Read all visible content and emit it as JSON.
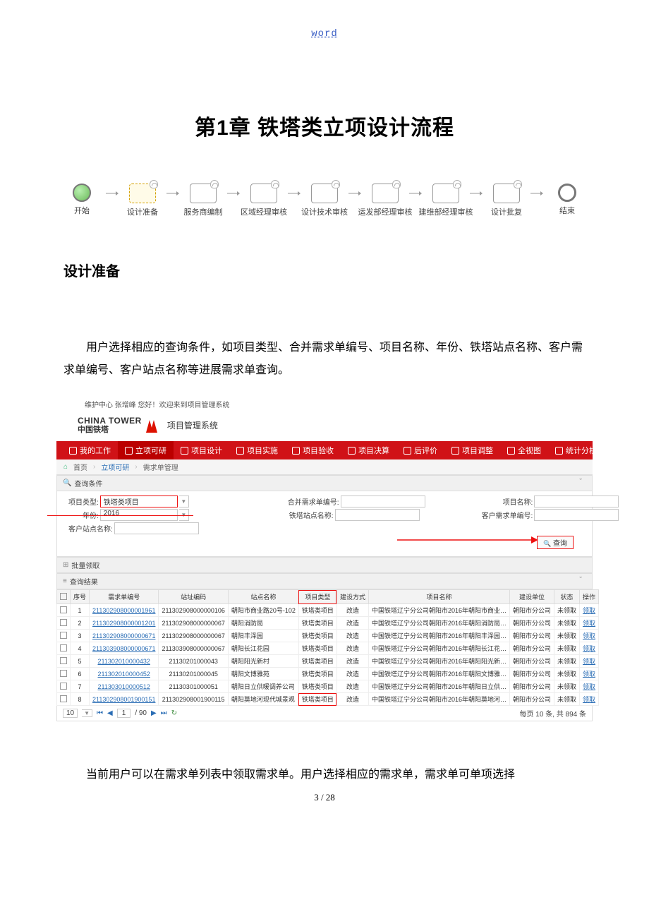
{
  "header_word": "word",
  "title": "第1章 铁塔类立项设计流程",
  "flow": [
    "开始",
    "设计准备",
    "服务商编制",
    "区域经理审核",
    "设计技术审核",
    "运发部经理审核",
    "建维部经理审核",
    "设计批复",
    "结束"
  ],
  "section_heading": "设计准备",
  "paragraph1": "用户选择相应的查询条件，如项目类型、合并需求单编号、项目名称、年份、铁塔站点名称、客户需求单编号、客户站点名称等进展需求单查询。",
  "ui": {
    "topbar": "维护中心   张增峰   您好！欢迎来到项目管理系统",
    "brand_en": "CHINA TOWER",
    "brand_cn": "中国铁塔",
    "brand_sys": "项目管理系统",
    "nav": [
      "我的工作",
      "立项可研",
      "项目设计",
      "项目实施",
      "项目验收",
      "项目决算",
      "后评价",
      "项目调整",
      "全视图",
      "统计分析"
    ],
    "crumbs": [
      "首页",
      "立项可研",
      "需求单管理"
    ],
    "panel_query": "查询条件",
    "form": {
      "f1_label": "项目类型:",
      "f1_value": "铁塔类项目",
      "f2_label": "合并需求单编号:",
      "f2_value": "",
      "f3_label": "项目名称:",
      "f3_value": "",
      "f4_label": "年份:",
      "f4_value": "2016",
      "f5_label": "铁塔站点名称:",
      "f5_value": "",
      "f6_label": "客户需求单编号:",
      "f6_value": "",
      "f7_label": "客户站点名称:",
      "f7_value": "",
      "search_btn": "查询"
    },
    "panel_batch": "批量领取",
    "panel_result": "查询结果",
    "cols": [
      "",
      "序号",
      "需求单编号",
      "站址编码",
      "站点名称",
      "项目类型",
      "建设方式",
      "项目名称",
      "建设单位",
      "状态",
      "操作"
    ],
    "rows": [
      {
        "n": "1",
        "req": "211302908000001961",
        "site": "211302908000000106",
        "name": "朝阳市商业路20号-102",
        "type": "铁塔类项目",
        "mode": "改造",
        "proj": "中国铁塔辽宁分公司朝阳市2016年朝阳市商业…",
        "unit": "朝阳市分公司",
        "st": "未领取",
        "op": "领取"
      },
      {
        "n": "2",
        "req": "211302908000001201",
        "site": "211302908000000067",
        "name": "朝阳消防局",
        "type": "铁塔类项目",
        "mode": "改造",
        "proj": "中国铁塔辽宁分公司朝阳市2016年朝阳消防局…",
        "unit": "朝阳市分公司",
        "st": "未领取",
        "op": "领取"
      },
      {
        "n": "3",
        "req": "211302908000000671",
        "site": "211302908000000067",
        "name": "朝阳丰泽园",
        "type": "铁塔类项目",
        "mode": "改造",
        "proj": "中国铁塔辽宁分公司朝阳市2016年朝阳丰泽园…",
        "unit": "朝阳市分公司",
        "st": "未领取",
        "op": "领取"
      },
      {
        "n": "4",
        "req": "211303908000000671",
        "site": "211303908000000067",
        "name": "朝阳长江花园",
        "type": "铁塔类项目",
        "mode": "改造",
        "proj": "中国铁塔辽宁分公司朝阳市2016年朝阳长江花…",
        "unit": "朝阳市分公司",
        "st": "未领取",
        "op": "领取"
      },
      {
        "n": "5",
        "req": "211302010000432",
        "site": "21130201000043",
        "name": "朝阳阳光新村",
        "type": "铁塔类项目",
        "mode": "改造",
        "proj": "中国铁塔辽宁分公司朝阳市2016年朝阳阳光新…",
        "unit": "朝阳市分公司",
        "st": "未领取",
        "op": "领取"
      },
      {
        "n": "6",
        "req": "211302010000452",
        "site": "21130201000045",
        "name": "朝阳文博雅苑",
        "type": "铁塔类项目",
        "mode": "改造",
        "proj": "中国铁塔辽宁分公司朝阳市2016年朝阳文博雅…",
        "unit": "朝阳市分公司",
        "st": "未领取",
        "op": "领取"
      },
      {
        "n": "7",
        "req": "211303010000512",
        "site": "21130301000051",
        "name": "朝阳日立供暖调养公司",
        "type": "铁塔类项目",
        "mode": "改造",
        "proj": "中国铁塔辽宁分公司朝阳市2016年朝阳日立供…",
        "unit": "朝阳市分公司",
        "st": "未领取",
        "op": "领取"
      },
      {
        "n": "8",
        "req": "211302908001900151",
        "site": "211302908001900115",
        "name": "朝阳莫地河现代城景观",
        "type": "铁塔类项目",
        "mode": "改造",
        "proj": "中国铁塔辽宁分公司朝阳市2016年朝阳莫地河…",
        "unit": "朝阳市分公司",
        "st": "未领取",
        "op": "领取"
      }
    ],
    "pager": {
      "size": "10",
      "page": "1",
      "total": "/ 90",
      "summary": "每页 10 条, 共 894 条"
    }
  },
  "paragraph2": "当前用户可以在需求单列表中领取需求单。用户选择相应的需求单，需求单可单项选择",
  "page_number": "3 / 28"
}
